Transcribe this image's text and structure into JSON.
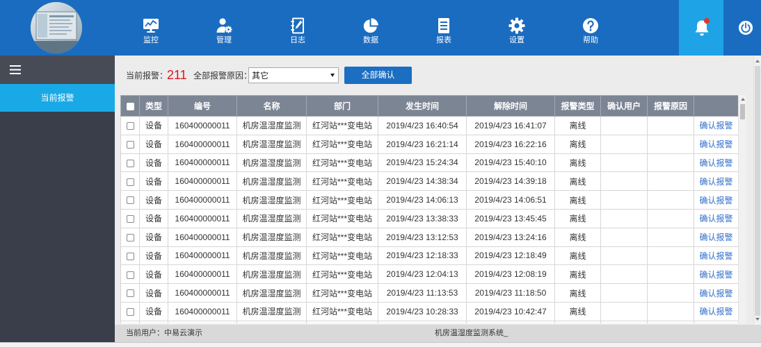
{
  "colors": {
    "header_bar": "#1a6cc0",
    "bell_bg": "#1ea3e6",
    "notification_dot": "#e8322d",
    "sidebar_active": "#19a9e6",
    "button": "#1b6ec2",
    "alarm_count": "#e0141e",
    "table_header": "#7c8594",
    "link": "#2f6fcb"
  },
  "header": {
    "avatar": "system-logo-avatar",
    "nav": [
      {
        "label": "监控",
        "icon": "monitor-chart-icon"
      },
      {
        "label": "管理",
        "icon": "user-gear-icon"
      },
      {
        "label": "日志",
        "icon": "notebook-pen-icon"
      },
      {
        "label": "数据",
        "icon": "pie-chart-icon"
      },
      {
        "label": "报表",
        "icon": "report-document-icon"
      },
      {
        "label": "设置",
        "icon": "gear-icon"
      },
      {
        "label": "帮助",
        "icon": "question-icon"
      }
    ],
    "bell_icon": "bell-icon",
    "power_icon": "power-icon"
  },
  "sidebar": {
    "menu_icon": "hamburger-icon",
    "items": [
      {
        "label": "当前报警",
        "active": true
      }
    ]
  },
  "toolbar": {
    "alarm_count_label": "当前报警：",
    "alarm_count": "211",
    "reason_label": "全部报警原因：",
    "reason_selected": "其它",
    "confirm_all_label": "全部确认"
  },
  "table": {
    "columns": [
      "类型",
      "编号",
      "名称",
      "部门",
      "发生时间",
      "解除时间",
      "报警类型",
      "确认用户",
      "报警原因"
    ],
    "rows": [
      {
        "type": "设备",
        "code": "160400000011",
        "name": "机房温湿度监测",
        "department": "红河站***变电站",
        "occurred": "2019/4/23 16:40:54",
        "cleared": "2019/4/23 16:41:07",
        "alarm_type": "离线",
        "confirm_user": "",
        "reason": "",
        "action": "确认报警"
      },
      {
        "type": "设备",
        "code": "160400000011",
        "name": "机房温湿度监测",
        "department": "红河站***变电站",
        "occurred": "2019/4/23 16:21:14",
        "cleared": "2019/4/23 16:22:16",
        "alarm_type": "离线",
        "confirm_user": "",
        "reason": "",
        "action": "确认报警"
      },
      {
        "type": "设备",
        "code": "160400000011",
        "name": "机房温湿度监测",
        "department": "红河站***变电站",
        "occurred": "2019/4/23 15:24:34",
        "cleared": "2019/4/23 15:40:10",
        "alarm_type": "离线",
        "confirm_user": "",
        "reason": "",
        "action": "确认报警"
      },
      {
        "type": "设备",
        "code": "160400000011",
        "name": "机房温湿度监测",
        "department": "红河站***变电站",
        "occurred": "2019/4/23 14:38:34",
        "cleared": "2019/4/23 14:39:18",
        "alarm_type": "离线",
        "confirm_user": "",
        "reason": "",
        "action": "确认报警"
      },
      {
        "type": "设备",
        "code": "160400000011",
        "name": "机房温湿度监测",
        "department": "红河站***变电站",
        "occurred": "2019/4/23 14:06:13",
        "cleared": "2019/4/23 14:06:51",
        "alarm_type": "离线",
        "confirm_user": "",
        "reason": "",
        "action": "确认报警"
      },
      {
        "type": "设备",
        "code": "160400000011",
        "name": "机房温湿度监测",
        "department": "红河站***变电站",
        "occurred": "2019/4/23 13:38:33",
        "cleared": "2019/4/23 13:45:45",
        "alarm_type": "离线",
        "confirm_user": "",
        "reason": "",
        "action": "确认报警"
      },
      {
        "type": "设备",
        "code": "160400000011",
        "name": "机房温湿度监测",
        "department": "红河站***变电站",
        "occurred": "2019/4/23 13:12:53",
        "cleared": "2019/4/23 13:24:16",
        "alarm_type": "离线",
        "confirm_user": "",
        "reason": "",
        "action": "确认报警"
      },
      {
        "type": "设备",
        "code": "160400000011",
        "name": "机房温湿度监测",
        "department": "红河站***变电站",
        "occurred": "2019/4/23 12:18:33",
        "cleared": "2019/4/23 12:18:49",
        "alarm_type": "离线",
        "confirm_user": "",
        "reason": "",
        "action": "确认报警"
      },
      {
        "type": "设备",
        "code": "160400000011",
        "name": "机房温湿度监测",
        "department": "红河站***变电站",
        "occurred": "2019/4/23 12:04:13",
        "cleared": "2019/4/23 12:08:19",
        "alarm_type": "离线",
        "confirm_user": "",
        "reason": "",
        "action": "确认报警"
      },
      {
        "type": "设备",
        "code": "160400000011",
        "name": "机房温湿度监测",
        "department": "红河站***变电站",
        "occurred": "2019/4/23 11:13:53",
        "cleared": "2019/4/23 11:18:50",
        "alarm_type": "离线",
        "confirm_user": "",
        "reason": "",
        "action": "确认报警"
      },
      {
        "type": "设备",
        "code": "160400000011",
        "name": "机房温湿度监测",
        "department": "红河站***变电站",
        "occurred": "2019/4/23 10:28:33",
        "cleared": "2019/4/23 10:42:47",
        "alarm_type": "离线",
        "confirm_user": "",
        "reason": "",
        "action": "确认报警"
      }
    ]
  },
  "footer": {
    "current_user": "当前用户：中易云演示",
    "system_name": "机房温湿度监测系统_"
  }
}
